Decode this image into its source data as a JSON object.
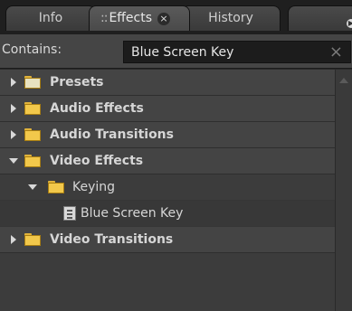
{
  "tabs": [
    {
      "label": "Info"
    },
    {
      "label": "Effects",
      "grip": "::",
      "close": "×"
    },
    {
      "label": "History"
    }
  ],
  "search": {
    "label": "Contains:",
    "value": "Blue Screen Key",
    "clear": "×"
  },
  "tree": [
    {
      "label": "Presets",
      "expanded": false,
      "level": 0
    },
    {
      "label": "Audio Effects",
      "expanded": false,
      "level": 0
    },
    {
      "label": "Audio Transitions",
      "expanded": false,
      "level": 0
    },
    {
      "label": "Video Effects",
      "expanded": true,
      "level": 0
    },
    {
      "label": "Keying",
      "expanded": true,
      "level": 1
    },
    {
      "label": "Blue Screen Key",
      "level": 2,
      "icon": "effect-icon"
    },
    {
      "label": "Video Transitions",
      "expanded": false,
      "level": 0
    }
  ],
  "colors": {
    "panel": "#3c3c3c",
    "folder": "#f2c84b",
    "tabbar": "#1f1f1f"
  }
}
